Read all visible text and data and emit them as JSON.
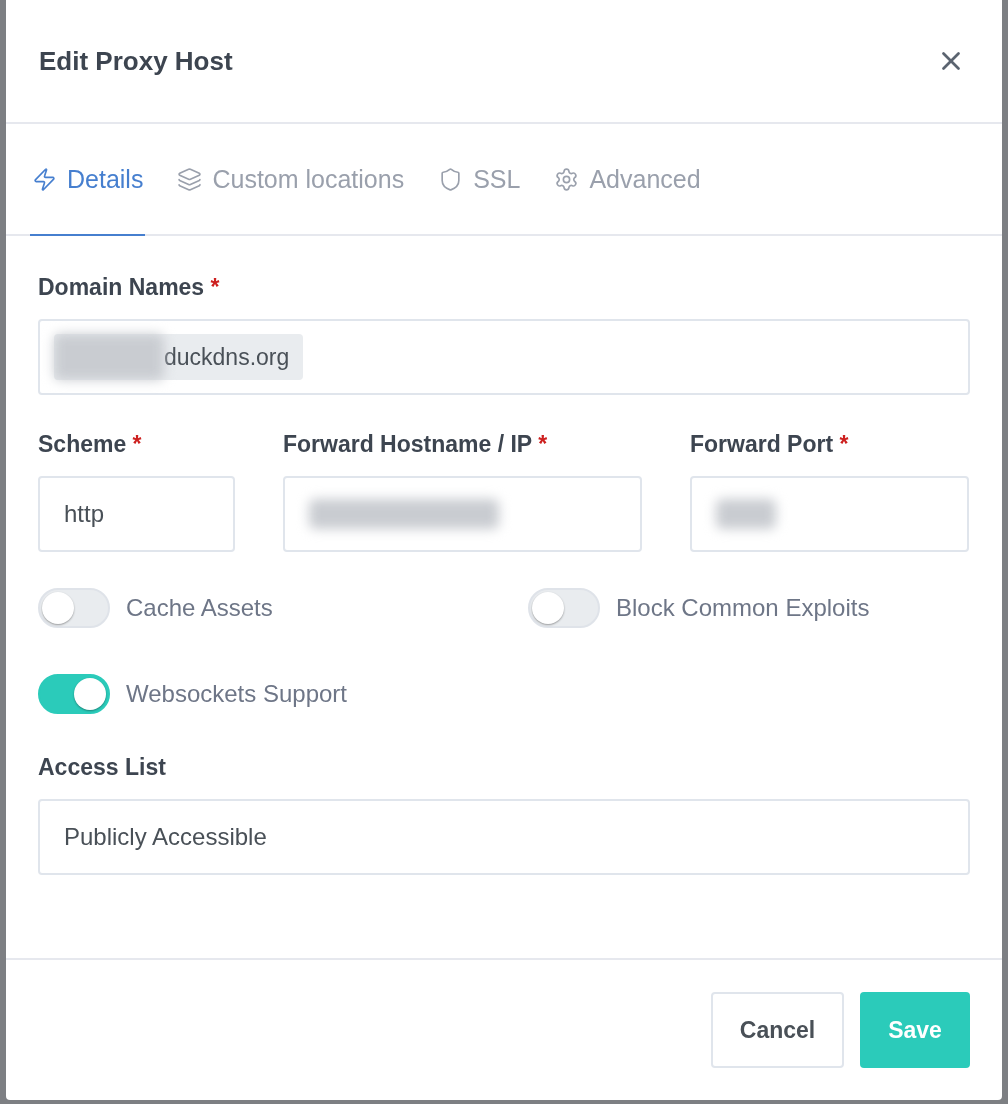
{
  "modal": {
    "title": "Edit Proxy Host"
  },
  "tabs": [
    {
      "label": "Details",
      "selected": true
    },
    {
      "label": "Custom locations",
      "selected": false
    },
    {
      "label": "SSL",
      "selected": false
    },
    {
      "label": "Advanced",
      "selected": false
    }
  ],
  "domain_names": {
    "label": "Domain Names",
    "required_mark": "*",
    "tags": [
      {
        "text": "duckdns.org",
        "blurred_prefix": true
      }
    ]
  },
  "forward": [
    {
      "label": "Scheme",
      "required_mark": "*",
      "value": "http",
      "blurred": false
    },
    {
      "label": "Forward Hostname / IP",
      "required_mark": "*",
      "blurred": true
    },
    {
      "label": "Forward Port",
      "required_mark": "*",
      "blurred": true
    }
  ],
  "toggles": [
    {
      "label": "Cache Assets",
      "on": false
    },
    {
      "label": "Block Common Exploits",
      "on": false
    },
    {
      "label": "Websockets Support",
      "on": true
    }
  ],
  "access_list": {
    "label": "Access List",
    "value": "Publicly Accessible"
  },
  "buttons": [
    {
      "label": "Cancel",
      "kind": "secondary"
    },
    {
      "label": "Save",
      "kind": "primary"
    }
  ]
}
